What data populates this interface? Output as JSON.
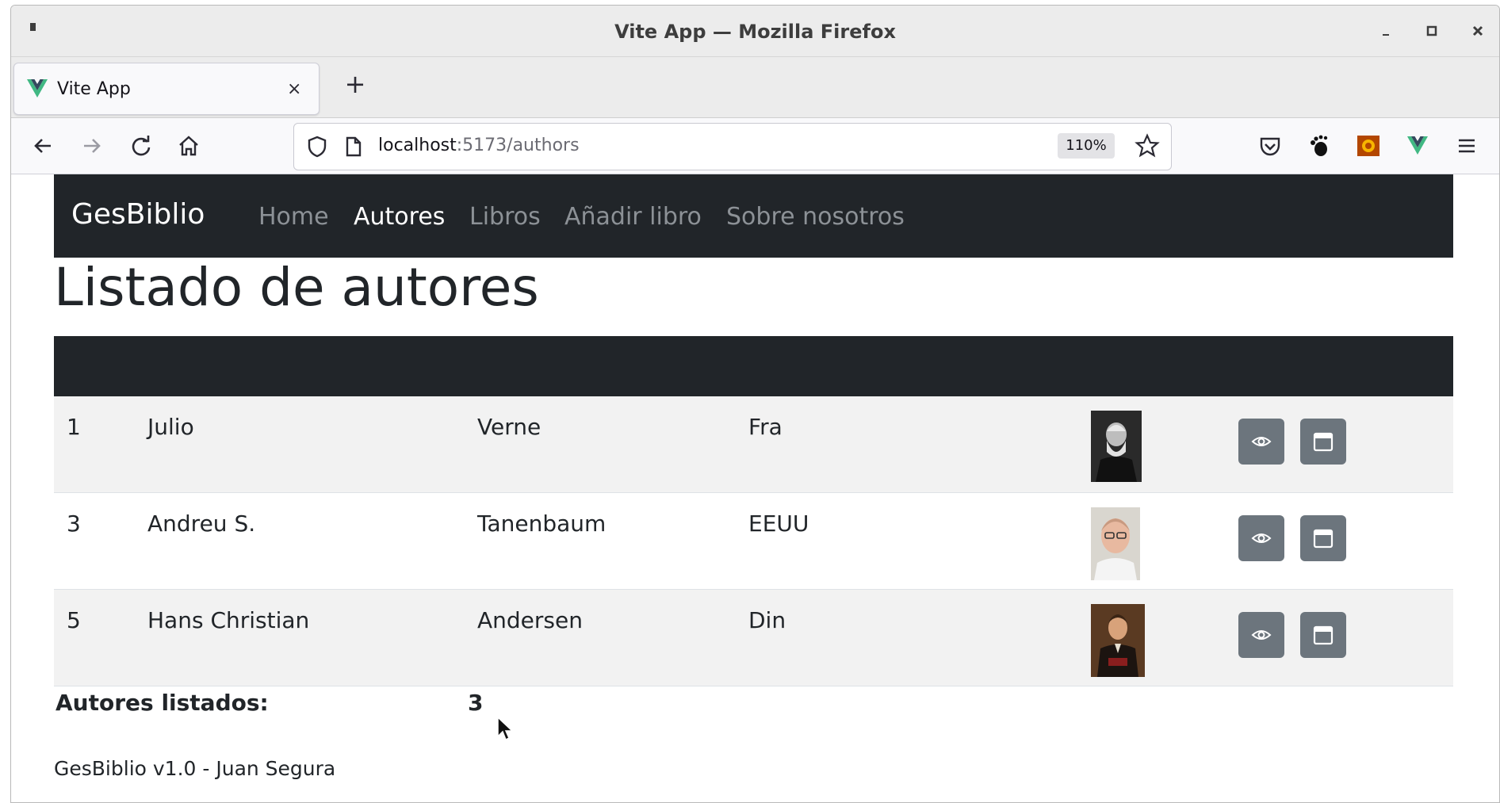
{
  "window": {
    "title": "Vite App — Mozilla Firefox"
  },
  "tab": {
    "label": "Vite App",
    "close": "×",
    "new_tab": "+"
  },
  "urlbar": {
    "host": "localhost",
    "path": ":5173/authors",
    "zoom": "110%"
  },
  "icons": {
    "back": "back-arrow-icon",
    "forward": "forward-arrow-icon",
    "reload": "reload-icon",
    "home": "home-icon",
    "shield": "shield-icon",
    "page": "page-icon",
    "bookmark": "star-icon",
    "pocket": "pocket-icon",
    "gnome": "gnome-foot-icon",
    "ext_orange": "extension-icon",
    "vue": "vue-devtools-icon",
    "menu": "hamburger-menu-icon"
  },
  "app": {
    "brand": "GesBiblio",
    "nav": [
      {
        "label": "Home",
        "active": false
      },
      {
        "label": "Autores",
        "active": true
      },
      {
        "label": "Libros",
        "active": false
      },
      {
        "label": "Añadir libro",
        "active": false
      },
      {
        "label": "Sobre nosotros",
        "active": false
      }
    ],
    "title": "Listado de autores"
  },
  "authors": [
    {
      "id": "1",
      "name": "Julio",
      "surname": "Verne",
      "country": "Fra"
    },
    {
      "id": "3",
      "name": "Andreu S.",
      "surname": "Tanenbaum",
      "country": "EEUU"
    },
    {
      "id": "5",
      "name": "Hans Christian",
      "surname": "Andersen",
      "country": "Din"
    }
  ],
  "summary": {
    "label": "Autores listados:",
    "count": "3"
  },
  "footer": {
    "text": "GesBiblio v1.0 - Juan Segura"
  },
  "colors": {
    "dark": "#212529",
    "button": "#6c757d",
    "stripe": "#f2f2f2"
  }
}
